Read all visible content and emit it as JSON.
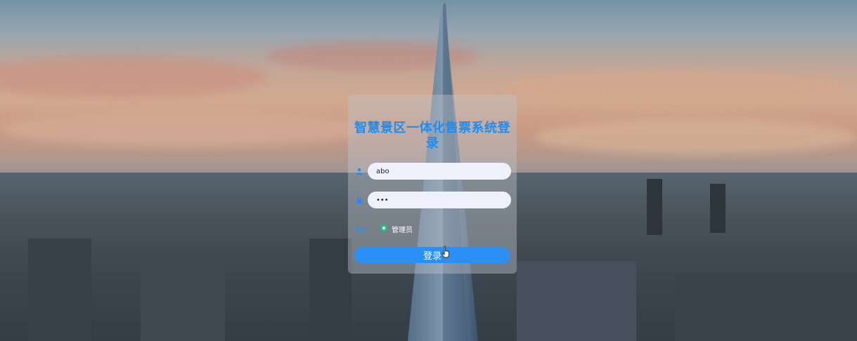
{
  "login": {
    "title": "智慧景区一体化售票系统登录",
    "username_value": "abo",
    "password_value": "•••",
    "role_label": "角色",
    "role_option": "管理员",
    "submit_label": "登录"
  },
  "colors": {
    "accent": "#1e8df0",
    "button": "#2a90f5",
    "radio": "#22c07a",
    "input_bg": "#eef0fb"
  },
  "icons": {
    "username": "user-icon",
    "password": "lock-icon",
    "cursor": "hand-pointer-icon"
  }
}
